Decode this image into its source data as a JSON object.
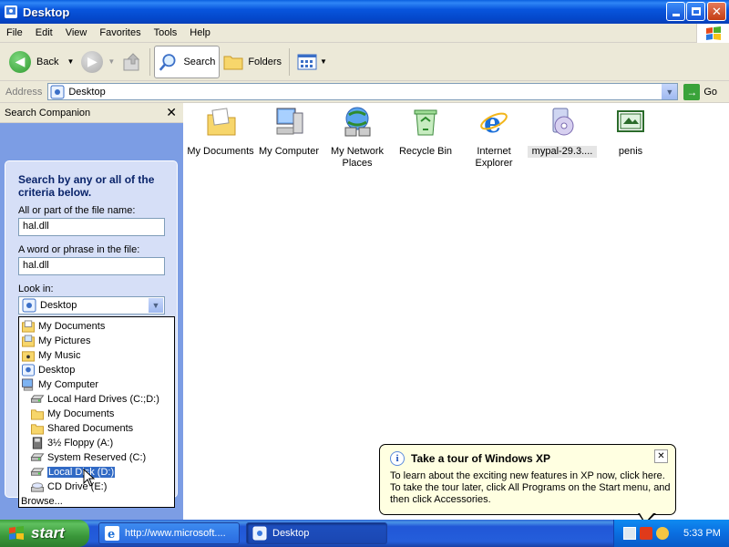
{
  "window": {
    "title": "Desktop",
    "buttons": [
      "minimize",
      "maximize",
      "close"
    ]
  },
  "menu": [
    "File",
    "Edit",
    "View",
    "Favorites",
    "Tools",
    "Help"
  ],
  "toolbar": {
    "back": "Back",
    "search": "Search",
    "folders": "Folders"
  },
  "address": {
    "label": "Address",
    "value": "Desktop",
    "go": "Go"
  },
  "companion": {
    "title": "Search Companion",
    "heading": "Search by any or all of the criteria below.",
    "filename_label": "All or part of the file name:",
    "filename_value": "hal.dll",
    "phrase_label": "A word or phrase in the file:",
    "phrase_value": "hal.dll",
    "lookin_label": "Look in:",
    "lookin_value": "Desktop",
    "lookin_options": [
      {
        "label": "My Documents",
        "icon": "my-documents-icon",
        "indent": 0
      },
      {
        "label": "My Pictures",
        "icon": "my-pictures-icon",
        "indent": 0
      },
      {
        "label": "My Music",
        "icon": "my-music-icon",
        "indent": 0
      },
      {
        "label": "Desktop",
        "icon": "desktop-icon",
        "indent": 0
      },
      {
        "label": "My Computer",
        "icon": "my-computer-icon",
        "indent": 0
      },
      {
        "label": "Local Hard Drives (C:;D:)",
        "icon": "hard-drive-icon",
        "indent": 1
      },
      {
        "label": "My Documents",
        "icon": "folder-icon",
        "indent": 1
      },
      {
        "label": "Shared Documents",
        "icon": "folder-icon",
        "indent": 1
      },
      {
        "label": "3½ Floppy (A:)",
        "icon": "floppy-icon",
        "indent": 1
      },
      {
        "label": "System Reserved (C:)",
        "icon": "hard-drive-icon",
        "indent": 1
      },
      {
        "label": "Local Disk (D:)",
        "icon": "hard-drive-icon",
        "indent": 1,
        "selected": true
      },
      {
        "label": "CD Drive (E:)",
        "icon": "cd-drive-icon",
        "indent": 1
      },
      {
        "label": "Browse...",
        "icon": "",
        "indent": 0
      }
    ]
  },
  "desktop_icons": [
    {
      "label": "My Documents",
      "icon": "my-documents-icon"
    },
    {
      "label": "My Computer",
      "icon": "my-computer-icon"
    },
    {
      "label": "My Network Places",
      "icon": "network-places-icon"
    },
    {
      "label": "Recycle Bin",
      "icon": "recycle-bin-icon"
    },
    {
      "label": "Internet Explorer",
      "icon": "internet-explorer-icon"
    },
    {
      "label": "mypal-29.3....",
      "icon": "installer-icon"
    },
    {
      "label": "penis",
      "icon": "image-file-icon"
    }
  ],
  "balloon": {
    "title": "Take a tour of Windows XP",
    "body": "To learn about the exciting new features in XP now, click here. To take the tour later, click All Programs on the Start menu, and then click Accessories."
  },
  "taskbar": {
    "start": "start",
    "tasks": [
      {
        "label": "http://www.microsoft....",
        "icon": "internet-explorer-icon"
      },
      {
        "label": "Desktop",
        "icon": "desktop-icon"
      }
    ],
    "clock": "5:33 PM"
  },
  "colors": {
    "titlebar": "#0a5fe0",
    "companion_bg": "#7c9de4",
    "taskbar": "#245edb",
    "start_green": "#3a973a",
    "selection": "#316ac5"
  }
}
